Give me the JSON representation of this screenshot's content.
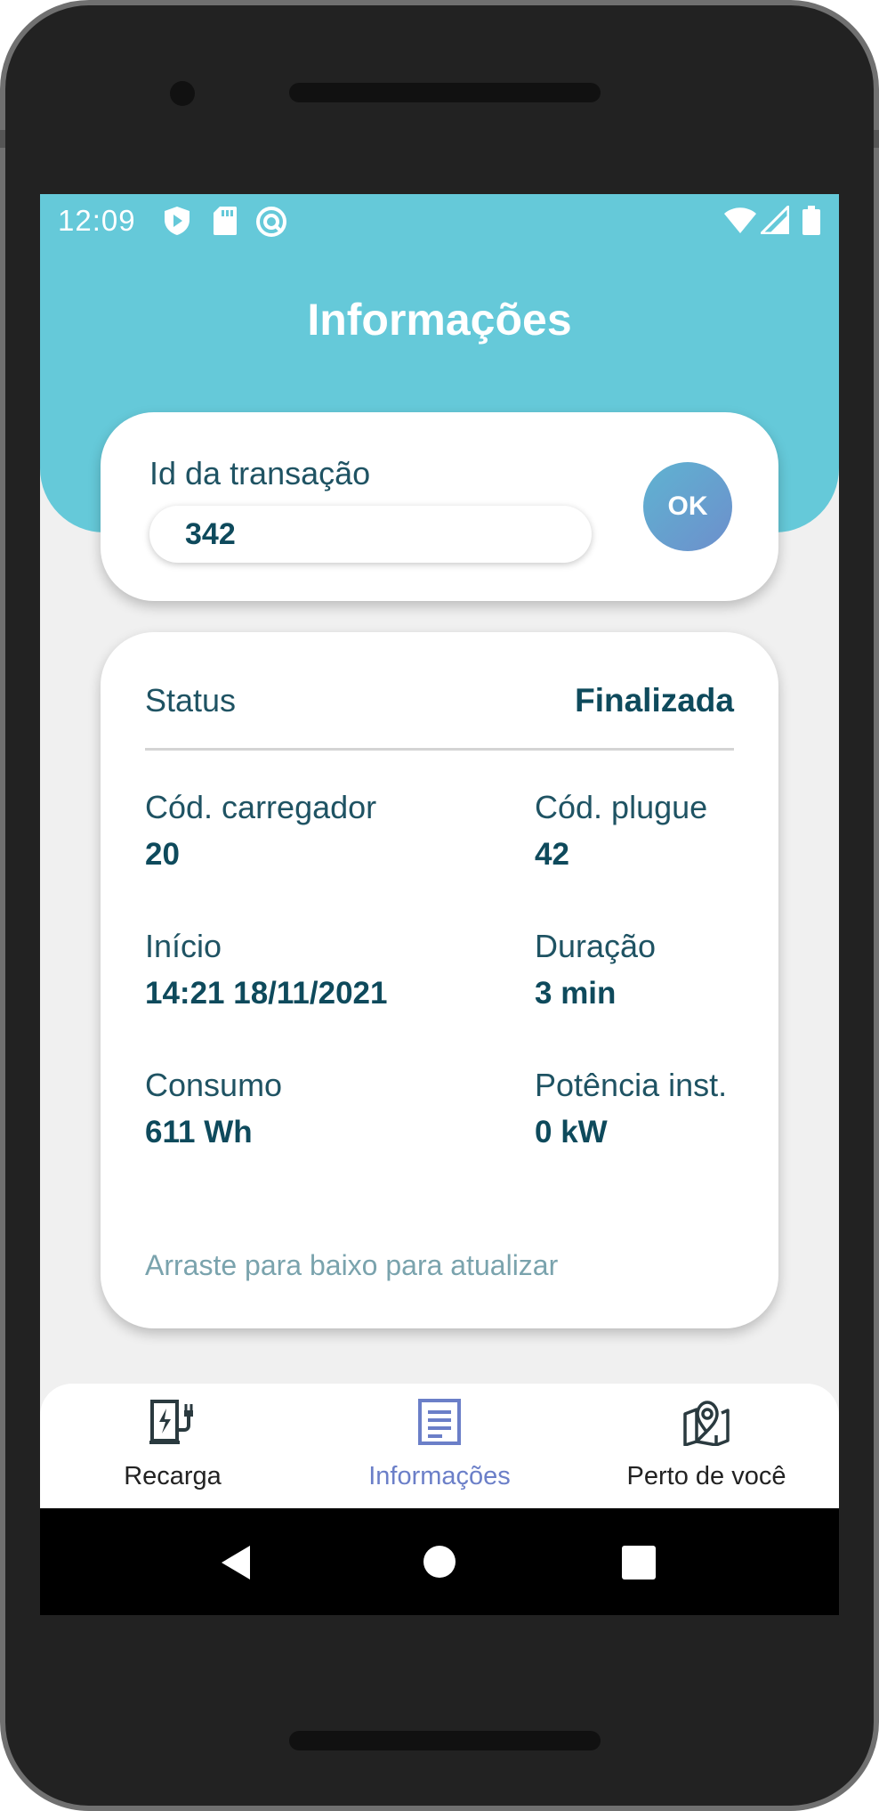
{
  "colors": {
    "header": "#65c9d9",
    "primary_text": "#0e4a5c",
    "label_text": "#1f5363",
    "hint_text": "#7aa3ad",
    "active_nav": "#6b7fc8"
  },
  "statusbar": {
    "time": "12:09",
    "left_icons": [
      "play-protect-icon",
      "sd-card-icon",
      "sync-icon"
    ],
    "right_icons": [
      "wifi-icon",
      "signal-icon",
      "battery-icon"
    ]
  },
  "header": {
    "title": "Informações"
  },
  "transaction": {
    "label": "Id da transação",
    "value": "342",
    "ok_label": "OK"
  },
  "info": {
    "status_label": "Status",
    "status_value": "Finalizada",
    "fields": [
      {
        "label": "Cód. carregador",
        "value": "20"
      },
      {
        "label": "Cód. plugue",
        "value": "42"
      },
      {
        "label": "Início",
        "value": "14:21 18/11/2021"
      },
      {
        "label": "Duração",
        "value": "3 min"
      },
      {
        "label": "Consumo",
        "value": "611 Wh"
      },
      {
        "label": "Potência inst.",
        "value": "0 kW"
      }
    ],
    "hint": "Arraste para baixo para atualizar"
  },
  "nav": {
    "items": [
      {
        "label": "Recarga",
        "icon": "ev-charger-icon",
        "active": false
      },
      {
        "label": "Informações",
        "icon": "document-icon",
        "active": true
      },
      {
        "label": "Perto de você",
        "icon": "map-pin-icon",
        "active": false
      }
    ]
  },
  "system_nav": [
    "back-icon",
    "home-icon",
    "recents-icon"
  ]
}
